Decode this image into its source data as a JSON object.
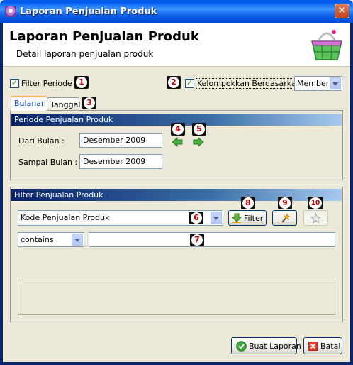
{
  "window": {
    "title": "Laporan Penjualan Produk",
    "close_glyph": "✕"
  },
  "header": {
    "title": "Laporan Penjualan Produk",
    "subtitle": "Detail laporan penjualan produk",
    "icon": "shopping-basket-icon"
  },
  "options": {
    "filter_periode_label": "Filter Periode",
    "filter_periode_checked": true,
    "group_by_label": "Kelompokkan Berdasarkan :",
    "group_by_checked": true,
    "group_by_value": "Member"
  },
  "tabs": [
    {
      "label": "Bulanan",
      "active": true
    },
    {
      "label": "Tanggal",
      "active": false
    }
  ],
  "periode": {
    "section_title": "Periode Penjualan Produk",
    "from_label": "Dari Bulan :",
    "from_value": "Desember 2009",
    "to_label": "Sampai Bulan :",
    "to_value": "Desember 2009"
  },
  "filter": {
    "section_title": "Filter Penjualan Produk",
    "field_value": "Kode Penjualan Produk",
    "operator_value": "contains",
    "criteria_value": "",
    "filter_button_label": "Filter"
  },
  "badges": [
    "1",
    "2",
    "3",
    "4",
    "5",
    "6",
    "7",
    "8",
    "9",
    "10"
  ],
  "footer": {
    "create_button_label": "Buat Laporan",
    "cancel_button_label": "Batal"
  },
  "colors": {
    "title_bar": "#0058ee",
    "section_bar": "#0a246a",
    "badge_text": "#c00000",
    "check": "#21a121"
  }
}
